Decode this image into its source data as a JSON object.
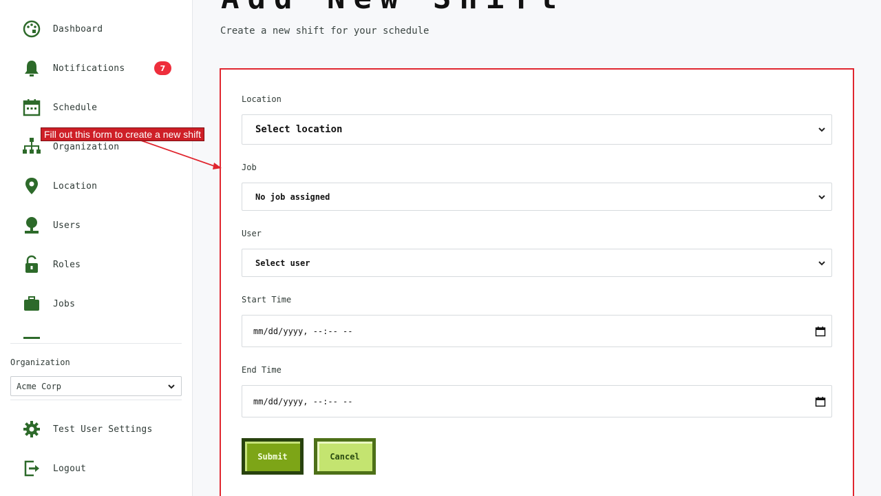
{
  "sidebar": {
    "items": [
      {
        "label": "Dashboard",
        "icon": "palette-icon"
      },
      {
        "label": "Notifications",
        "icon": "bell-icon",
        "badge": "7"
      },
      {
        "label": "Schedule",
        "icon": "calendar-icon"
      },
      {
        "label": "Organization",
        "icon": "org-chart-icon"
      },
      {
        "label": "Location",
        "icon": "map-pin-icon"
      },
      {
        "label": "Users",
        "icon": "user-icon"
      },
      {
        "label": "Roles",
        "icon": "unlock-icon"
      },
      {
        "label": "Jobs",
        "icon": "briefcase-icon"
      }
    ],
    "organization_label": "Organization",
    "organization_value": "Acme Corp",
    "settings_label": "Test User Settings",
    "logout_label": "Logout"
  },
  "main": {
    "title": "Add New Shift",
    "subtitle": "Create a new shift for your schedule",
    "form": {
      "location_label": "Location",
      "location_value": "Select location",
      "job_label": "Job",
      "job_value": "No job assigned",
      "user_label": "User",
      "user_value": "Select user",
      "start_label": "Start Time",
      "start_value": "mm/dd/yyyy, --:-- --",
      "end_label": "End Time",
      "end_value": "mm/dd/yyyy, --:-- --",
      "submit_label": "Submit",
      "cancel_label": "Cancel"
    }
  },
  "annotation": "Fill out this form to create a new shift",
  "colors": {
    "icon_green": "#2d6a2a",
    "badge_red": "#ee2e3c",
    "highlight_red": "#e0262f",
    "submit_green": "#7da517",
    "cancel_green": "#c4e470"
  }
}
